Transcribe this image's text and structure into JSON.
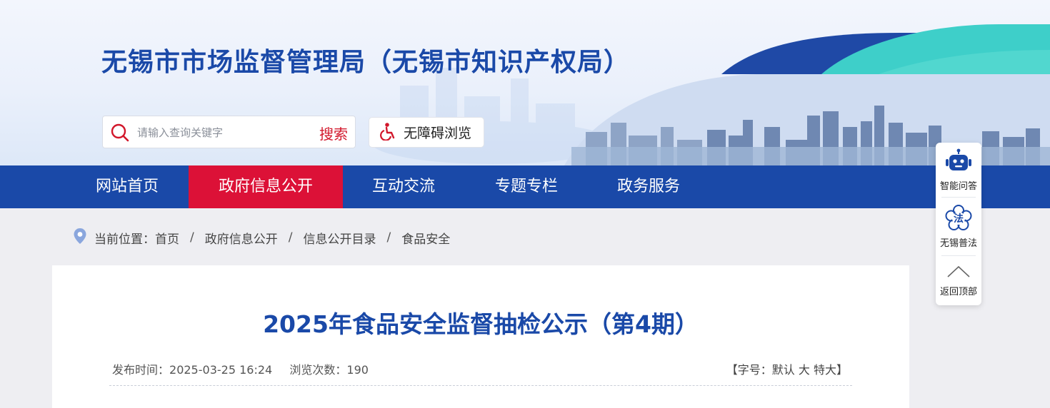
{
  "header": {
    "site_title": "无锡市市场监督管理局（无锡市知识产权局）",
    "search_placeholder": "请输入查询关键字",
    "search_button": "搜索",
    "accessibility_label": "无障碍浏览"
  },
  "nav": {
    "items": [
      {
        "label": "网站首页"
      },
      {
        "label": "政府信息公开"
      },
      {
        "label": "互动交流"
      },
      {
        "label": "专题专栏"
      },
      {
        "label": "政务服务"
      }
    ],
    "active_index": 1
  },
  "breadcrumb": {
    "prefix": "当前位置：",
    "items": [
      "首页",
      "政府信息公开",
      "信息公开目录",
      "食品安全"
    ],
    "separator": "/"
  },
  "article": {
    "title": "2025年食品安全监督抽检公示（第4期）",
    "publish_label": "发布时间：",
    "publish_time": "2025-03-25 16:24",
    "views_label": "浏览次数：",
    "views": "190",
    "font_size": {
      "open": "【",
      "label": "字号：",
      "options": [
        "默认",
        "大",
        "特大"
      ],
      "close": "】"
    }
  },
  "float_toolbar": {
    "items": [
      {
        "label": "智能问答",
        "icon": "robot-icon"
      },
      {
        "label": "无锡普法",
        "icon": "law-flower-icon"
      },
      {
        "label": "返回顶部",
        "icon": "chevron-up-icon"
      }
    ]
  },
  "colors": {
    "primary": "#1a49a8",
    "nav_active": "#dc1137",
    "search_button": "#d2172b",
    "teal_accent": "#3ecfc9"
  }
}
